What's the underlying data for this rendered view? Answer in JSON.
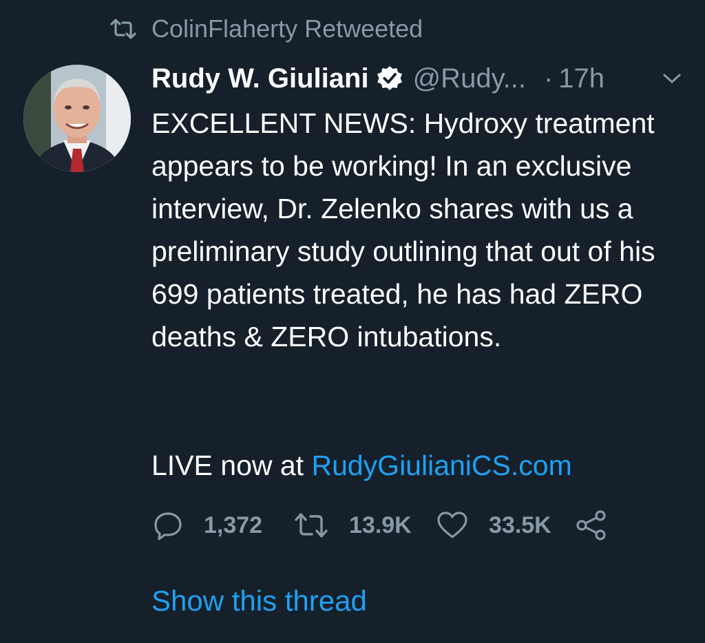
{
  "colors": {
    "background": "#15202b",
    "primary_text": "#ffffff",
    "secondary_text": "#8899a6",
    "link": "#1da1f2"
  },
  "social_context": {
    "icon": "retweet-icon",
    "text": "ColinFlaherty Retweeted"
  },
  "tweet": {
    "avatar": "profile-photo",
    "display_name": "Rudy W. Giuliani",
    "verified_icon": "verified-badge-icon",
    "handle": "@Rudy...",
    "separator": "·",
    "timestamp": "17h",
    "menu_icon": "chevron-down-icon",
    "text": "EXCELLENT NEWS: Hydroxy treatment appears to be working! In an exclusive interview, Dr. Zelenko shares with us a preliminary study outlining that out of his 699 patients treated, he has had ZERO deaths & ZERO intubations.",
    "live_prefix": "LIVE now at ",
    "link_text": "RudyGiulianiCS.com"
  },
  "actions": {
    "reply": {
      "icon": "reply-icon",
      "count": "1,372"
    },
    "retweet": {
      "icon": "retweet-icon",
      "count": "13.9K"
    },
    "like": {
      "icon": "heart-icon",
      "count": "33.5K"
    },
    "share": {
      "icon": "share-icon"
    }
  },
  "show_thread": "Show this thread"
}
